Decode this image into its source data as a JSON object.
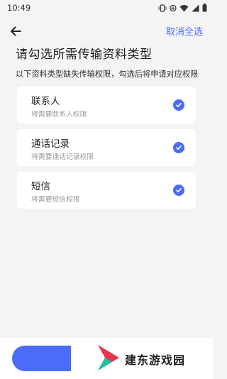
{
  "status_bar": {
    "time": "10:49"
  },
  "header": {
    "back_icon": "arrow-left-icon",
    "cancel_all_label": "取消全选"
  },
  "main": {
    "title": "请勾选所需传输资料类型",
    "hint": "以下资料类型缺失传输权限，勾选后将申请对应权限",
    "items": [
      {
        "title": "联系人",
        "subtitle": "将需要联系人权限",
        "checked": true
      },
      {
        "title": "通话记录",
        "subtitle": "将需要通话记录权限",
        "checked": true
      },
      {
        "title": "短信",
        "subtitle": "将需要短信权限",
        "checked": true
      }
    ]
  },
  "watermark": {
    "text": "建东游戏园"
  },
  "colors": {
    "accent": "#4a6cf7",
    "background": "#f4f4f7",
    "card": "#ffffff"
  }
}
